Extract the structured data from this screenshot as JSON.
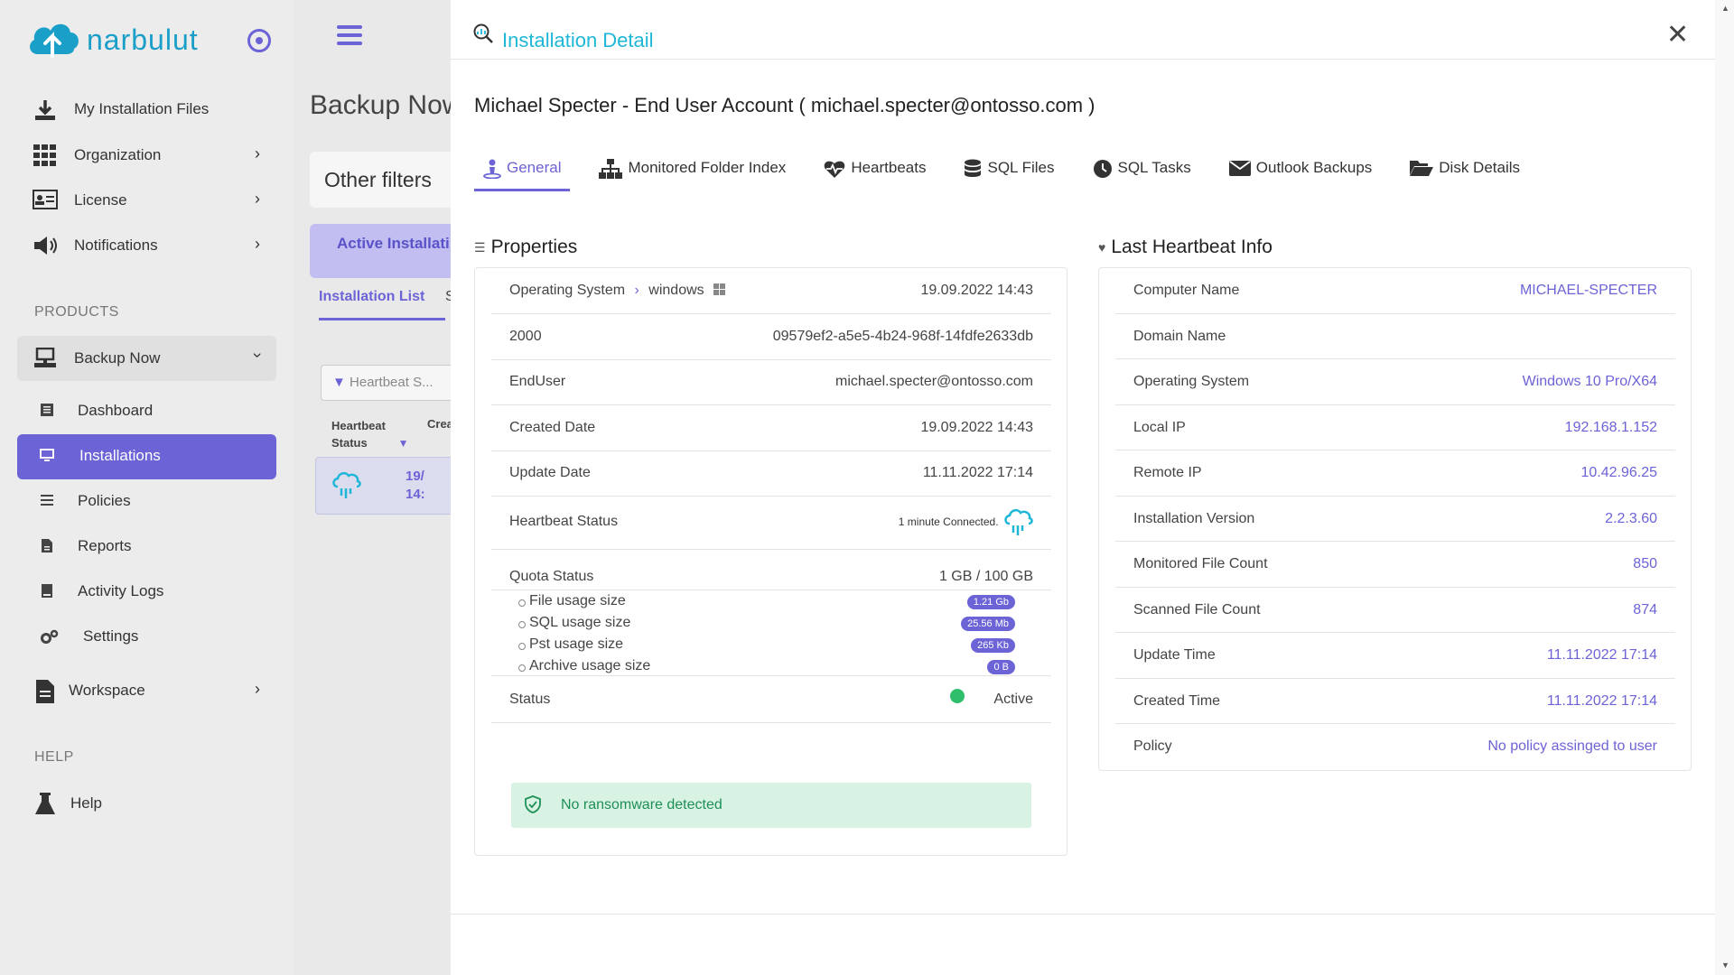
{
  "sidebar": {
    "logo_text": "narbulut",
    "items": [
      {
        "label": "My Installation Files",
        "icon": "download-icon"
      },
      {
        "label": "Organization",
        "icon": "grid-icon"
      },
      {
        "label": "License",
        "icon": "id-card-icon"
      },
      {
        "label": "Notifications",
        "icon": "speaker-icon"
      }
    ],
    "products_label": "PRODUCTS",
    "product": "Backup Now",
    "sub_items": [
      {
        "label": "Dashboard",
        "icon": "list-icon"
      },
      {
        "label": "Installations",
        "icon": "monitor-icon"
      },
      {
        "label": "Policies",
        "icon": "lines-icon"
      },
      {
        "label": "Reports",
        "icon": "file-icon"
      },
      {
        "label": "Activity Logs",
        "icon": "book-icon"
      },
      {
        "label": "Settings",
        "icon": "gears-icon"
      }
    ],
    "workspace": "Workspace",
    "help_label": "HELP",
    "help": "Help"
  },
  "background": {
    "page_title": "Backup Now",
    "other_filters": "Other filters",
    "active_installations": "Active Installati",
    "installation_list_tab": "Installation List",
    "second_tab_initial": "S",
    "heartbeat_filter": "Heartbeat S...",
    "col_heartbeat": "Heartbeat Status",
    "col_created": "Crea",
    "row_date_1": "19/",
    "row_date_2": "14:"
  },
  "modal": {
    "title": "Installation Detail",
    "account_title": "Michael Specter - End User Account ( michael.specter@ontosso.com )",
    "tabs": [
      {
        "label": "General",
        "icon": "person-icon"
      },
      {
        "label": "Monitored Folder Index",
        "icon": "sitemap-icon"
      },
      {
        "label": "Heartbeats",
        "icon": "heart-pulse-icon"
      },
      {
        "label": "SQL Files",
        "icon": "database-icon"
      },
      {
        "label": "SQL Tasks",
        "icon": "clock-icon"
      },
      {
        "label": "Outlook Backups",
        "icon": "envelope-icon"
      },
      {
        "label": "Disk Details",
        "icon": "folder-open-icon"
      }
    ],
    "properties": {
      "title": "Properties",
      "os_label": "Operating System",
      "os_value": "windows",
      "os_date": "19.09.2022 14:43",
      "id_label": "2000",
      "id_value": "09579ef2-a5e5-4b24-968f-14fdfe2633db",
      "enduser_label": "EndUser",
      "enduser_value": "michael.specter@ontosso.com",
      "created_label": "Created Date",
      "created_value": "19.09.2022 14:43",
      "update_label": "Update Date",
      "update_value": "11.11.2022 17:14",
      "heartbeat_label": "Heartbeat Status",
      "heartbeat_value": "1 minute Connected.",
      "quota_label": "Quota Status",
      "quota_value": "1 GB / 100 GB",
      "quota_items": [
        {
          "label": "File usage size",
          "badge": "1.21 Gb"
        },
        {
          "label": "SQL usage size",
          "badge": "25.56 Mb"
        },
        {
          "label": "Pst usage size",
          "badge": "265 Kb"
        },
        {
          "label": "Archive usage size",
          "badge": "0 B"
        }
      ],
      "status_label": "Status",
      "status_value": "Active",
      "ransomware": "No ransomware detected"
    },
    "heartbeat": {
      "title": "Last Heartbeat Info",
      "rows": [
        {
          "label": "Computer Name",
          "value": "MICHAEL-SPECTER"
        },
        {
          "label": "Domain Name",
          "value": ""
        },
        {
          "label": "Operating System",
          "value": "Windows 10 Pro/X64"
        },
        {
          "label": "Local IP",
          "value": "192.168.1.152"
        },
        {
          "label": "Remote IP",
          "value": "10.42.96.25"
        },
        {
          "label": "Installation Version",
          "value": "2.2.3.60"
        },
        {
          "label": "Monitored File Count",
          "value": "850"
        },
        {
          "label": "Scanned File Count",
          "value": "874"
        },
        {
          "label": "Update Time",
          "value": "11.11.2022 17:14"
        },
        {
          "label": "Created Time",
          "value": "11.11.2022 17:14"
        },
        {
          "label": "Policy",
          "value": "No policy assinged to user"
        }
      ]
    }
  },
  "colors": {
    "accent": "#6c63d6",
    "title_cyan": "#1fb7d7",
    "success": "#2fbf6b"
  }
}
